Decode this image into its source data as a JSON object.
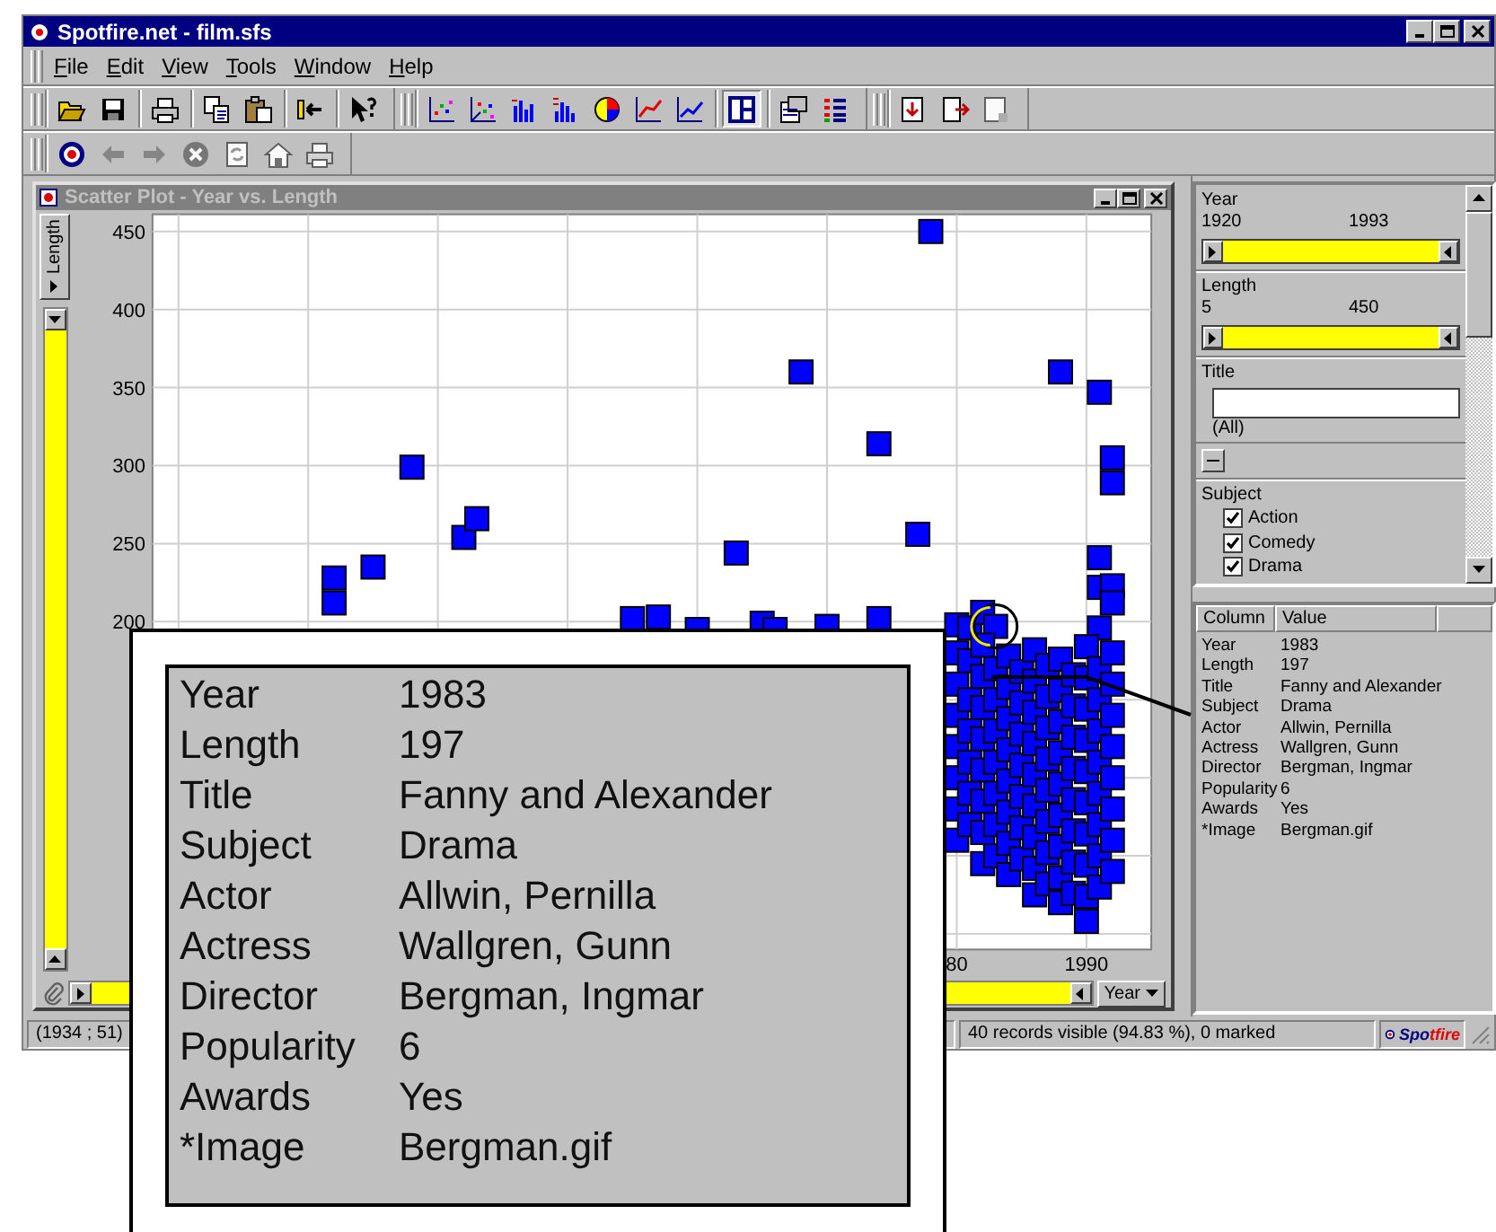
{
  "window": {
    "title": "Spotfire.net - film.sfs"
  },
  "menu": [
    "File",
    "Edit",
    "View",
    "Tools",
    "Window",
    "Help"
  ],
  "toolbar_rows": [
    {
      "toolbars": [
        {
          "groups": [
            [
              {
                "kind": "open",
                "pressed": false,
                "disabled": false
              },
              {
                "kind": "save",
                "pressed": false,
                "disabled": false
              }
            ],
            [
              {
                "kind": "print",
                "pressed": false,
                "disabled": false
              }
            ],
            [
              {
                "kind": "copy",
                "pressed": false,
                "disabled": false
              },
              {
                "kind": "paste",
                "pressed": false,
                "disabled": false
              }
            ],
            [
              {
                "kind": "import",
                "pressed": false,
                "disabled": false
              }
            ],
            [
              {
                "kind": "help",
                "pressed": false,
                "disabled": false
              }
            ]
          ]
        },
        {
          "groups": [
            [
              {
                "kind": "scatter",
                "pressed": false,
                "disabled": false
              },
              {
                "kind": "scatter-3d",
                "pressed": false,
                "disabled": false
              },
              {
                "kind": "bar",
                "pressed": false,
                "disabled": false
              },
              {
                "kind": "histogram",
                "pressed": false,
                "disabled": false
              },
              {
                "kind": "pie",
                "pressed": false,
                "disabled": false
              },
              {
                "kind": "profile",
                "pressed": false,
                "disabled": false
              },
              {
                "kind": "line",
                "pressed": false,
                "disabled": false
              }
            ],
            [
              {
                "kind": "layout",
                "pressed": true,
                "disabled": false
              }
            ],
            [
              {
                "kind": "properties",
                "pressed": false,
                "disabled": false
              },
              {
                "kind": "legend",
                "pressed": false,
                "disabled": false
              }
            ]
          ]
        },
        {
          "groups": [
            [
              {
                "kind": "window-in",
                "pressed": false,
                "disabled": false
              },
              {
                "kind": "window-out",
                "pressed": false,
                "disabled": false
              },
              {
                "kind": "window-blank",
                "pressed": false,
                "disabled": true
              }
            ]
          ]
        }
      ]
    },
    {
      "toolbars": [
        {
          "groups": [
            [
              {
                "kind": "logo",
                "pressed": false,
                "disabled": false
              },
              {
                "kind": "back",
                "pressed": false,
                "disabled": true
              },
              {
                "kind": "forward",
                "pressed": false,
                "disabled": true
              },
              {
                "kind": "stop",
                "pressed": false,
                "disabled": true
              },
              {
                "kind": "refresh",
                "pressed": false,
                "disabled": true
              },
              {
                "kind": "home",
                "pressed": false,
                "disabled": true
              },
              {
                "kind": "print",
                "pressed": false,
                "disabled": true
              }
            ]
          ]
        }
      ]
    }
  ],
  "plot_window": {
    "title": "Scatter Plot - Year vs. Length",
    "y_axis": "Length",
    "x_axis": "Year",
    "y_slider": {
      "level": 1
    },
    "x_slider": {
      "level": 1
    },
    "chart_data": {
      "type": "scatter",
      "x": [
        1932,
        1932,
        1935,
        1938,
        1942,
        1943,
        1955,
        1957,
        1960,
        1963,
        1965,
        1966,
        1968,
        1970,
        1974,
        1974,
        1977,
        1978,
        1980,
        1981,
        1982,
        1983,
        1988,
        1991,
        1992,
        1992,
        1991,
        1991,
        1992,
        1992,
        1991,
        1980,
        1980,
        1980,
        1980,
        1980,
        1980,
        1980,
        1981,
        1981,
        1981,
        1981,
        1981,
        1981,
        1982,
        1982,
        1982,
        1982,
        1982,
        1982,
        1982,
        1982,
        1983,
        1983,
        1983,
        1983,
        1983,
        1983,
        1983,
        1984,
        1984,
        1984,
        1984,
        1984,
        1984,
        1984,
        1984,
        1985,
        1985,
        1985,
        1985,
        1985,
        1985,
        1985,
        1986,
        1986,
        1986,
        1986,
        1986,
        1986,
        1986,
        1986,
        1986,
        1987,
        1987,
        1987,
        1987,
        1987,
        1987,
        1987,
        1987,
        1988,
        1988,
        1988,
        1988,
        1988,
        1988,
        1988,
        1988,
        1988,
        1989,
        1989,
        1989,
        1989,
        1989,
        1989,
        1989,
        1989,
        1990,
        1990,
        1990,
        1990,
        1990,
        1990,
        1990,
        1990,
        1990,
        1990,
        1991,
        1991,
        1991,
        1991,
        1991,
        1991,
        1991,
        1991,
        1992,
        1992,
        1992,
        1992,
        1992,
        1992,
        1992,
        1992
      ],
      "series": [
        {
          "color": "#0000ff",
          "values": [
            228,
            212,
            235,
            299,
            254,
            266,
            202,
            203,
            195,
            244,
            199,
            195,
            360,
            197,
            314,
            202,
            256,
            450,
            198,
            196,
            206,
            197,
            360,
            347,
            305,
            289,
            241,
            222,
            223,
            212,
            196,
            180,
            160,
            140,
            120,
            100,
            80,
            60,
            175,
            150,
            130,
            110,
            90,
            70,
            185,
            165,
            145,
            125,
            105,
            85,
            65,
            45,
            170,
            150,
            130,
            110,
            90,
            70,
            50,
            178,
            158,
            138,
            118,
            98,
            78,
            58,
            38,
            168,
            148,
            128,
            108,
            88,
            68,
            48,
            182,
            162,
            142,
            122,
            102,
            82,
            62,
            42,
            25,
            172,
            152,
            132,
            112,
            92,
            72,
            52,
            32,
            176,
            156,
            136,
            116,
            96,
            76,
            56,
            36,
            20,
            166,
            146,
            126,
            106,
            86,
            66,
            46,
            26,
            184,
            164,
            144,
            124,
            104,
            84,
            64,
            44,
            24,
            8,
            170,
            150,
            130,
            110,
            90,
            70,
            50,
            30,
            180,
            160,
            140,
            120,
            100,
            80,
            60,
            40
          ]
        }
      ],
      "xlim": [
        1918,
        1995
      ],
      "ylim": [
        -10,
        461
      ],
      "xticks": [
        {
          "value": 1980,
          "label": "80"
        },
        1990
      ],
      "yticks": [
        200,
        250,
        300,
        350,
        400,
        450
      ],
      "grid": true
    }
  },
  "filters": [
    {
      "kind": "range",
      "label": "Year",
      "min": "1920",
      "max": "1993",
      "level": 1
    },
    {
      "kind": "range",
      "label": "Length",
      "min": "5",
      "max": "450",
      "level": 1
    },
    {
      "kind": "text",
      "label": "Title",
      "note": "(All)"
    },
    {
      "kind": "checklist",
      "label": "Subject",
      "options": [
        {
          "label": "Action",
          "checked": true
        },
        {
          "label": "Comedy",
          "checked": true
        },
        {
          "label": "Drama",
          "checked": true
        }
      ]
    }
  ],
  "details": {
    "columns": [
      "Column",
      "Value"
    ],
    "rows": [
      {
        "column": "Year",
        "value": "1983"
      },
      {
        "column": "Length",
        "value": "197"
      },
      {
        "column": "Title",
        "value": "Fanny and Alexander"
      },
      {
        "column": "Subject",
        "value": "Drama"
      },
      {
        "column": "Actor",
        "value": "Allwin, Pernilla"
      },
      {
        "column": "Actress",
        "value": "Wallgren, Gunn"
      },
      {
        "column": "Director",
        "value": "Bergman, Ingmar"
      },
      {
        "column": "Popularity",
        "value": "6"
      },
      {
        "column": "Awards",
        "value": "Yes"
      },
      {
        "column": "*Image",
        "value": "Bergman.gif"
      }
    ]
  },
  "callout": {
    "rows": [
      {
        "label": "Year",
        "value": "1983"
      },
      {
        "label": "Length",
        "value": "197"
      },
      {
        "label": "Title",
        "value": "Fanny and Alexander"
      },
      {
        "label": "Subject",
        "value": "Drama"
      },
      {
        "label": "Actor",
        "value": "Allwin, Pernilla"
      },
      {
        "label": "Actress",
        "value": "Wallgren, Gunn"
      },
      {
        "label": "Director",
        "value": "Bergman, Ingmar"
      },
      {
        "label": "Popularity",
        "value": "6"
      },
      {
        "label": "Awards",
        "value": "Yes"
      },
      {
        "label": "*Image",
        "value": "Bergman.gif"
      }
    ]
  },
  "status_bar": {
    "coordinates": "(1934 ; 51)",
    "records": "40 records visible (94.83 %), 0 marked",
    "logo": "Spotfire"
  }
}
